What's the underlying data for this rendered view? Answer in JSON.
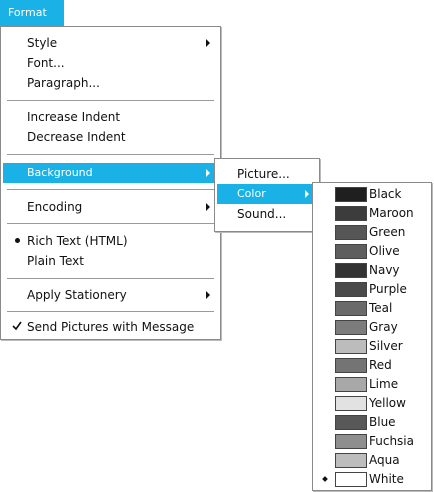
{
  "menu_title": "Format",
  "main_menu": {
    "items": [
      {
        "label": "Style",
        "submenu": true
      },
      {
        "label": "Font...",
        "submenu": false
      },
      {
        "label": "Paragraph...",
        "submenu": false
      },
      {
        "label": "Increase Indent",
        "submenu": false
      },
      {
        "label": "Decrease Indent",
        "submenu": false
      },
      {
        "label": "Background",
        "submenu": true,
        "highlighted": true
      },
      {
        "label": "Encoding",
        "submenu": true
      },
      {
        "label": "Rich Text (HTML)",
        "selected": true
      },
      {
        "label": "Plain Text"
      },
      {
        "label": "Apply Stationery",
        "submenu": true
      },
      {
        "label": "Send Pictures with Message",
        "checked": true
      }
    ]
  },
  "background_menu": {
    "items": [
      {
        "label": "Picture..."
      },
      {
        "label": "Color",
        "submenu": true,
        "highlighted": true
      },
      {
        "label": "Sound..."
      }
    ]
  },
  "color_menu": {
    "items": [
      {
        "label": "Black",
        "swatch": "#1f1f1f"
      },
      {
        "label": "Maroon",
        "swatch": "#3c3c3c"
      },
      {
        "label": "Green",
        "swatch": "#565656"
      },
      {
        "label": "Olive",
        "swatch": "#5e5e5e"
      },
      {
        "label": "Navy",
        "swatch": "#333333"
      },
      {
        "label": "Purple",
        "swatch": "#4a4a4a"
      },
      {
        "label": "Teal",
        "swatch": "#6a6a6a"
      },
      {
        "label": "Gray",
        "swatch": "#7c7c7c"
      },
      {
        "label": "Silver",
        "swatch": "#bcbcbc"
      },
      {
        "label": "Red",
        "swatch": "#747474"
      },
      {
        "label": "Lime",
        "swatch": "#a8a8a8"
      },
      {
        "label": "Yellow",
        "swatch": "#e2e2e2"
      },
      {
        "label": "Blue",
        "swatch": "#585858"
      },
      {
        "label": "Fuchsia",
        "swatch": "#8e8e8e"
      },
      {
        "label": "Aqua",
        "swatch": "#bdbdbd"
      },
      {
        "label": "White",
        "swatch": "#ffffff",
        "selected": true
      }
    ]
  },
  "colors": {
    "highlight": "#1ab2e6",
    "menu_border": "#8a8a8a"
  }
}
